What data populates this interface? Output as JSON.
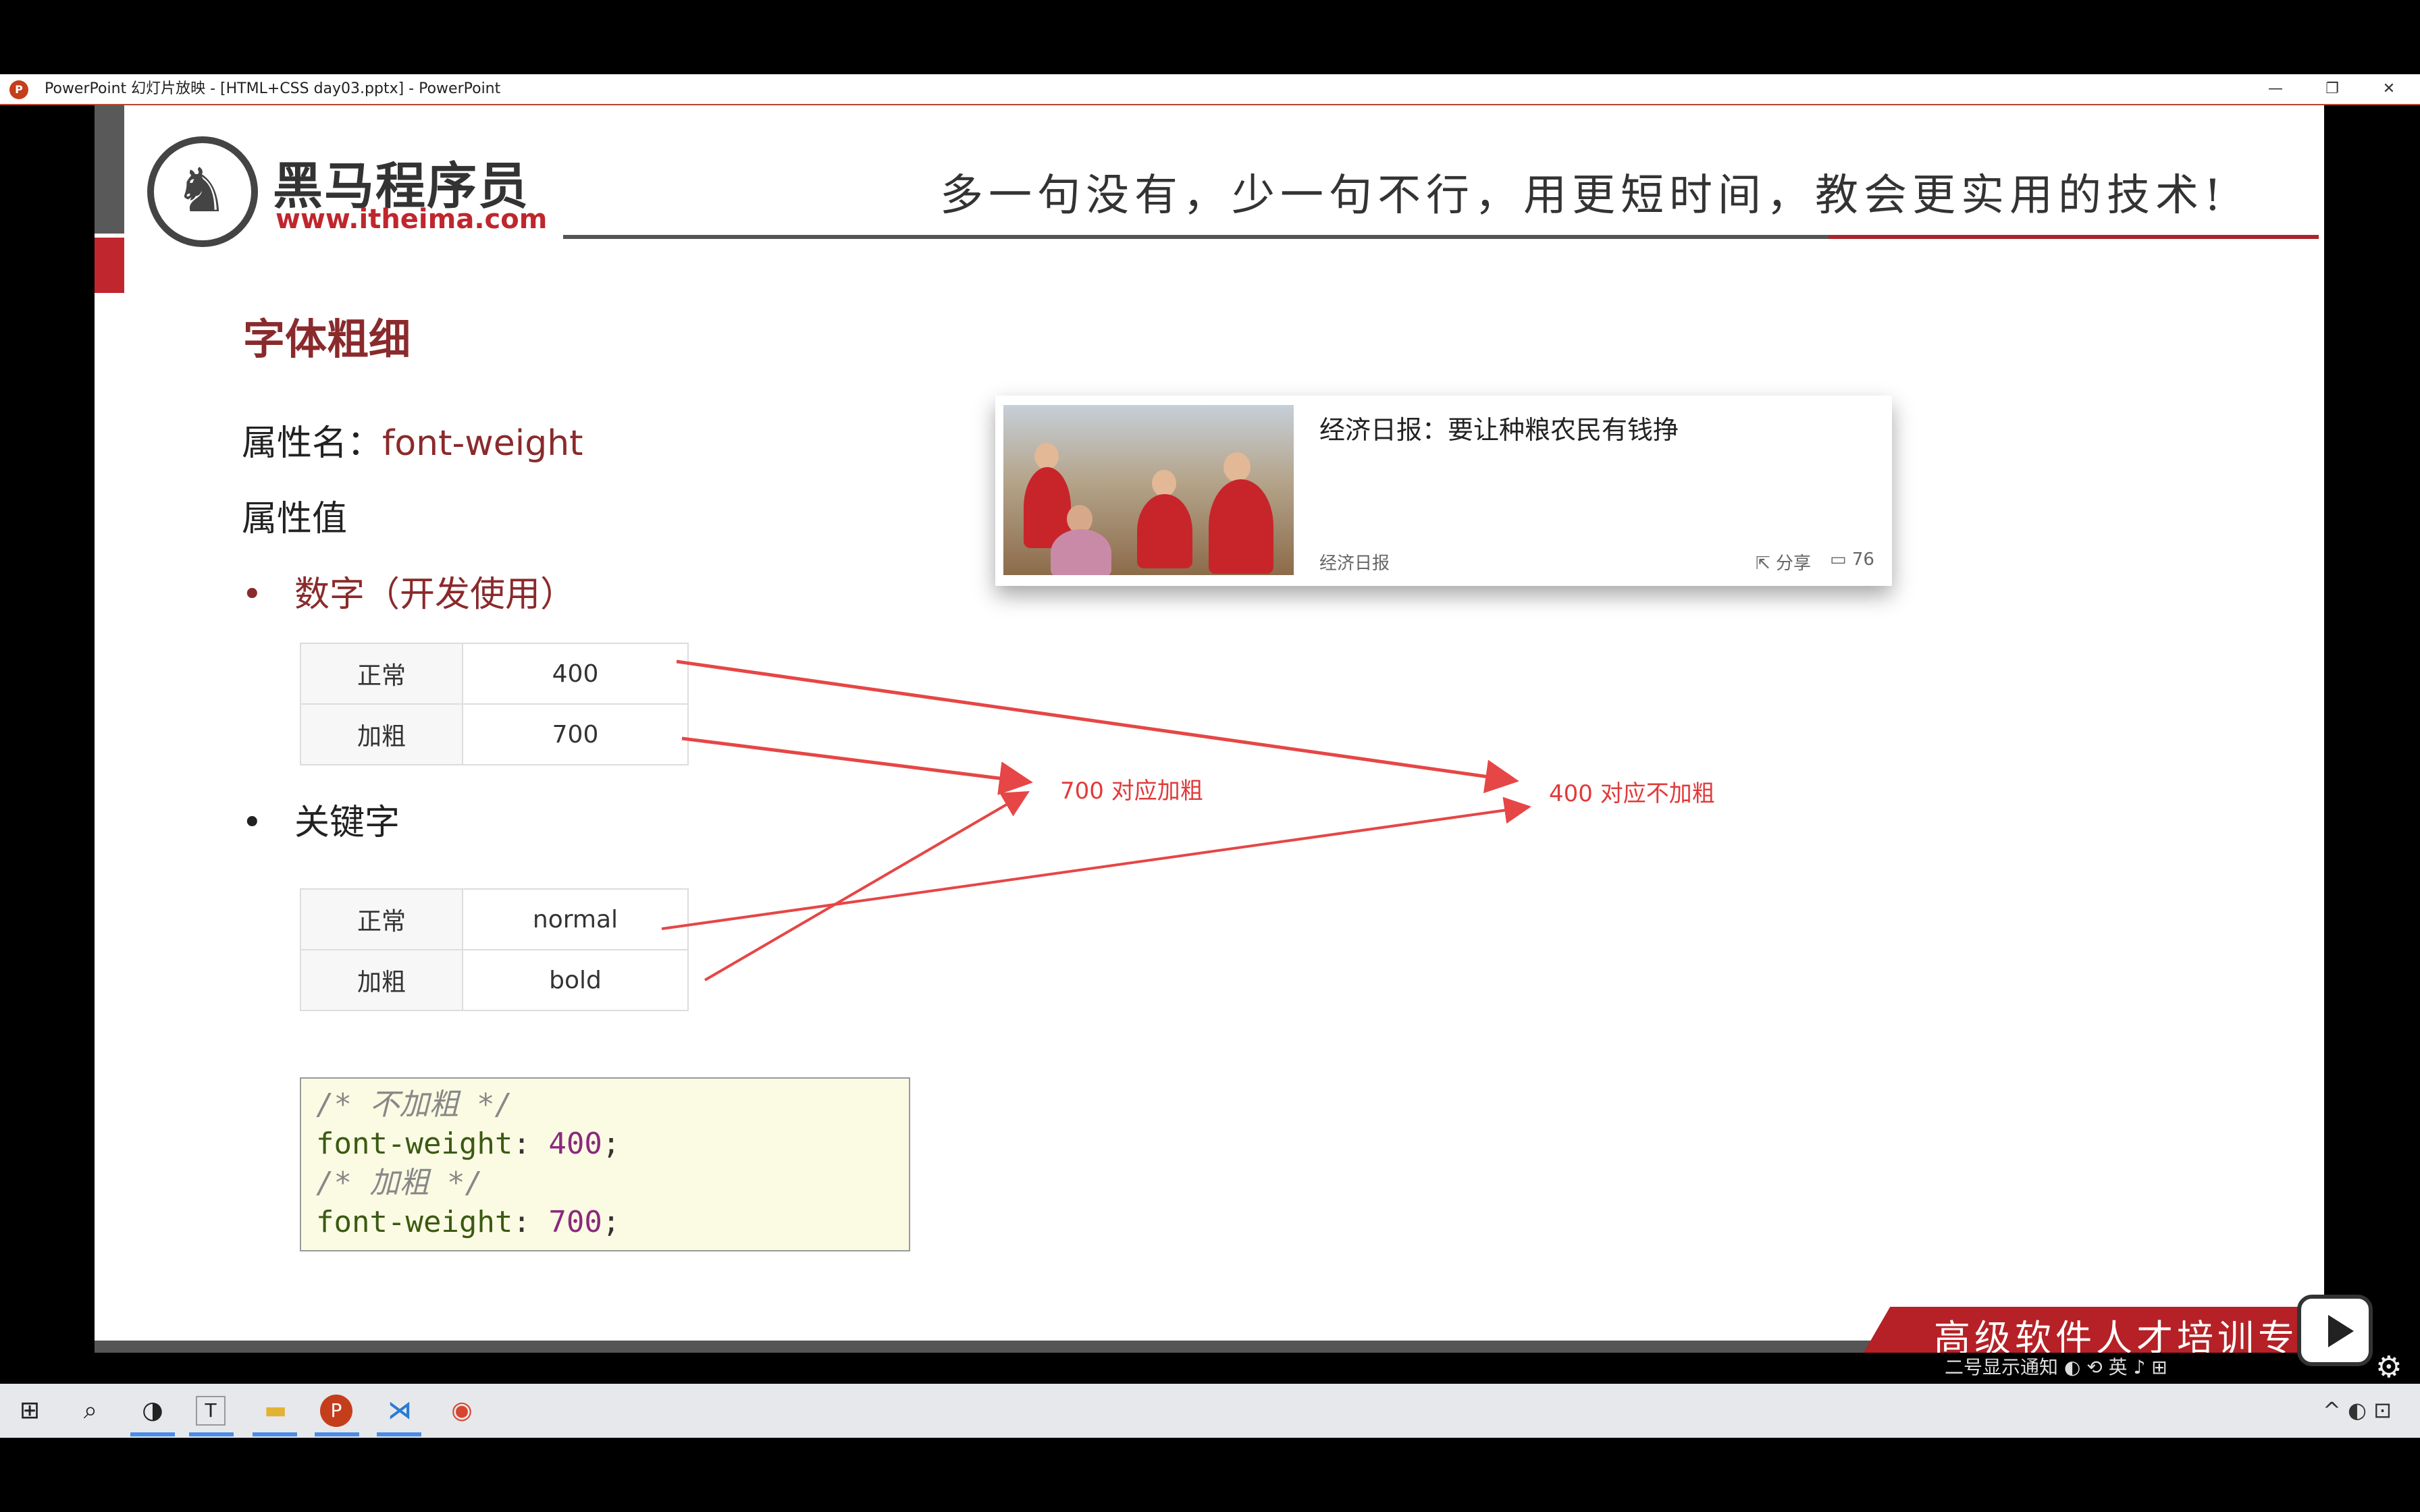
{
  "window": {
    "title": "PowerPoint 幻灯片放映 - [HTML+CSS day03.pptx] - PowerPoint",
    "minimize": "—",
    "restore": "❐",
    "close": "✕"
  },
  "slide": {
    "logo_cn": "黑马程序员",
    "logo_url": "www.itheima.com",
    "slogan": "多一句没有，少一句不行，用更短时间，教会更实用的技术!",
    "heading": "字体粗细",
    "prop_label": "属性名：",
    "prop_name": "font-weight",
    "prop_values": "属性值",
    "bullet_numbers": "数字（开发使用）",
    "bullet_keywords": "关键字",
    "table_numeric": [
      {
        "label": "正常",
        "value": "400"
      },
      {
        "label": "加粗",
        "value": "700"
      }
    ],
    "table_keyword": [
      {
        "label": "正常",
        "value": "normal"
      },
      {
        "label": "加粗",
        "value": "bold"
      }
    ],
    "code": {
      "comment1": "/* 不加粗 */",
      "prop1": "font-weight",
      "value1": "400",
      "comment2": "/* 加粗 */",
      "prop2": "font-weight",
      "value2": "700"
    },
    "news_card": {
      "title": "经济日报：要让种粮农民有钱挣",
      "source": "经济日报",
      "share": "⇱ 分享",
      "comments": "▭ 76"
    },
    "annotation_700": "700 对应加粗",
    "annotation_400": "400 对应不加粗",
    "footer_text": "高级软件人才培训专家",
    "arrow_color": "#e64646"
  },
  "controls": {
    "text": "二号显示通知 ◐  ⟲  英 ♪  ⊞",
    "gear": "⚙"
  },
  "taskbar": {
    "start": "⊞",
    "search": "⌕",
    "apps": [
      "◑",
      "T",
      "▬",
      "P",
      "⋊",
      "◉"
    ],
    "tray": "^  ◐  ⊡"
  }
}
